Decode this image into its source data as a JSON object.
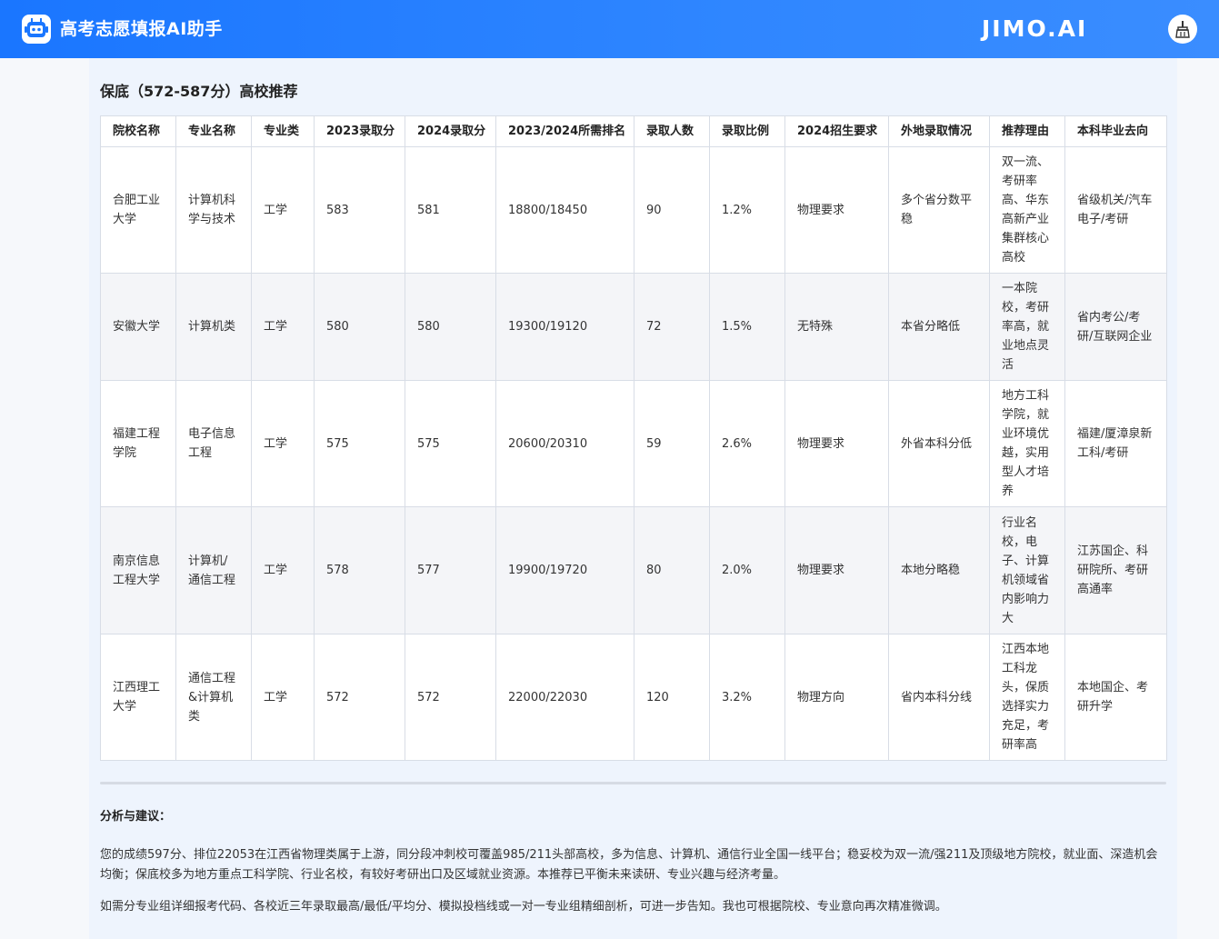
{
  "header": {
    "app_title": "高考志愿填报AI助手",
    "brand": "JIMO.AI",
    "logo_icon": "robot-icon",
    "clear_icon": "broom-icon",
    "background": "#1a76ff"
  },
  "section": {
    "title": "保底（572-587分）高校推荐"
  },
  "table": {
    "columns": [
      "院校名称",
      "专业名称",
      "专业类",
      "2023录取分",
      "2024录取分",
      "2023/2024所需排名",
      "录取人数",
      "录取比例",
      "2024招生要求",
      "外地录取情况",
      "推荐理由",
      "本科毕业去向"
    ],
    "rows": [
      [
        "合肥工业大学",
        "计算机科学与技术",
        "工学",
        "583",
        "581",
        "18800/18450",
        "90",
        "1.2%",
        "物理要求",
        "多个省分数平稳",
        "双一流、考研率高、华东高新产业集群核心高校",
        "省级机关/汽车电子/考研"
      ],
      [
        "安徽大学",
        "计算机类",
        "工学",
        "580",
        "580",
        "19300/19120",
        "72",
        "1.5%",
        "无特殊",
        "本省分略低",
        "一本院校，考研率高，就业地点灵活",
        "省内考公/考研/互联网企业"
      ],
      [
        "福建工程学院",
        "电子信息工程",
        "工学",
        "575",
        "575",
        "20600/20310",
        "59",
        "2.6%",
        "物理要求",
        "外省本科分低",
        "地方工科学院，就业环境优越，实用型人才培养",
        "福建/厦漳泉新工科/考研"
      ],
      [
        "南京信息工程大学",
        "计算机/通信工程",
        "工学",
        "578",
        "577",
        "19900/19720",
        "80",
        "2.0%",
        "物理要求",
        "本地分略稳",
        "行业名校，电子、计算机领域省内影响力大",
        "江苏国企、科研院所、考研高通率"
      ],
      [
        "江西理工大学",
        "通信工程&计算机类",
        "工学",
        "572",
        "572",
        "22000/22030",
        "120",
        "3.2%",
        "物理方向",
        "省内本科分线",
        "江西本地工科龙头，保质选择实力充足，考研率高",
        "本地国企、考研升学"
      ]
    ]
  },
  "analysis": {
    "title": "分析与建议：",
    "para1": "您的成绩597分、排位22053在江西省物理类属于上游，同分段冲刺校可覆盖985/211头部高校，多为信息、计算机、通信行业全国一线平台；稳妥校为双一流/强211及顶级地方院校，就业面、深造机会均衡；保底校多为地方重点工科学院、行业名校，有较好考研出口及区域就业资源。本推荐已平衡未来读研、专业兴趣与经济考量。",
    "para2": "如需分专业组详细报考代码、各校近三年录取最高/最低/平均分、模拟投档线或一对一专业组精细剖析，可进一步告知。我也可根据院校、专业意向再次精准微调。"
  }
}
